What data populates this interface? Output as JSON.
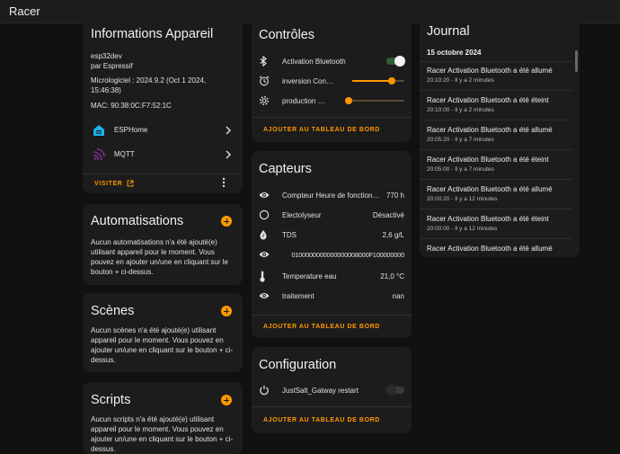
{
  "app": {
    "title": "Racer"
  },
  "device_info": {
    "title": "Informations Appareil",
    "model": "esp32dev",
    "manufacturer": "par Espressif",
    "firmware": "Micrologiciel : 2024.9.2 (Oct 1 2024, 15:46:38)",
    "mac": "MAC: 90:38:0C:F7:52:1C",
    "integrations": [
      {
        "label": "ESPHome",
        "icon": "esphome-icon"
      },
      {
        "label": "MQTT",
        "icon": "mqtt-icon"
      }
    ],
    "visit_label": "VISITER"
  },
  "automations": {
    "title": "Automatisations",
    "text": "Aucun automatisations n'a été ajouté(e) utilisant appareil pour le moment. Vous pouvez en ajouter un/une en cliquant sur le bouton + ci-dessus."
  },
  "scenes": {
    "title": "Scènes",
    "text": "Aucun scènes n'a été ajouté(e) utilisant appareil pour le moment. Vous pouvez en ajouter un/une en cliquant sur le bouton + ci-dessus."
  },
  "scripts": {
    "title": "Scripts",
    "text": "Aucun scripts n'a été ajouté(e) utilisant appareil pour le moment. Vous pouvez en ajouter un/une en cliquant sur le bouton + ci-dessus."
  },
  "controls": {
    "title": "Contrôles",
    "items": [
      {
        "label": "Activation Bluetooth",
        "icon": "bluetooth-icon",
        "type": "toggle",
        "on": true
      },
      {
        "label": "inversion Con…",
        "icon": "timer-icon",
        "type": "slider",
        "level": 0.75
      },
      {
        "label": "production Co…",
        "icon": "gear-icon",
        "type": "slider",
        "level": 0.0
      }
    ],
    "add_label": "AJOUTER AU TABLEAU DE BORD"
  },
  "sensors": {
    "title": "Capteurs",
    "items": [
      {
        "label": "Compteur Heure de fonction…",
        "value": "770 h",
        "icon": "eye-icon"
      },
      {
        "label": "Electolyseur",
        "value": "Désactivé",
        "icon": "circle-outline-icon"
      },
      {
        "label": "TDS",
        "value": "2,6 g/L",
        "icon": "water-drop-icon"
      },
      {
        "label": "",
        "value": "0100000000000000008000F100000000",
        "icon": "eye-icon"
      },
      {
        "label": "Temperature eau",
        "value": "21,0 °C",
        "icon": "thermometer-icon"
      },
      {
        "label": "traitement",
        "value": "nan",
        "icon": "eye-icon"
      }
    ],
    "add_label": "AJOUTER AU TABLEAU DE BORD"
  },
  "configuration": {
    "title": "Configuration",
    "items": [
      {
        "label": "JustSalt_Gatway restart",
        "icon": "restart-icon",
        "type": "toggle",
        "on": false
      }
    ],
    "add_label": "AJOUTER AU TABLEAU DE BORD"
  },
  "journal": {
    "title": "Journal",
    "date": "15 octobre 2024",
    "entries": [
      {
        "text": "Racer Activation Bluetooth a été allumé",
        "time": "20:10:20 - Il y a 2 minutes"
      },
      {
        "text": "Racer Activation Bluetooth a été éteint",
        "time": "20:10:00 - Il y a 2 minutes"
      },
      {
        "text": "Racer Activation Bluetooth a été allumé",
        "time": "20:05:20 - Il y a 7 minutes"
      },
      {
        "text": "Racer Activation Bluetooth a été éteint",
        "time": "20:05:00 - Il y a 7 minutes"
      },
      {
        "text": "Racer Activation Bluetooth a été allumé",
        "time": "20:00:20 - Il y a 12 minutes"
      },
      {
        "text": "Racer Activation Bluetooth a été éteint",
        "time": "20:00:00 - Il y a 12 minutes"
      },
      {
        "text": "Racer Activation Bluetooth a été allumé",
        "time": ""
      }
    ]
  },
  "colors": {
    "accent": "#ff9800",
    "toggle_on": "#4caf50",
    "card": "#1c1c1c",
    "background": "#111111"
  }
}
